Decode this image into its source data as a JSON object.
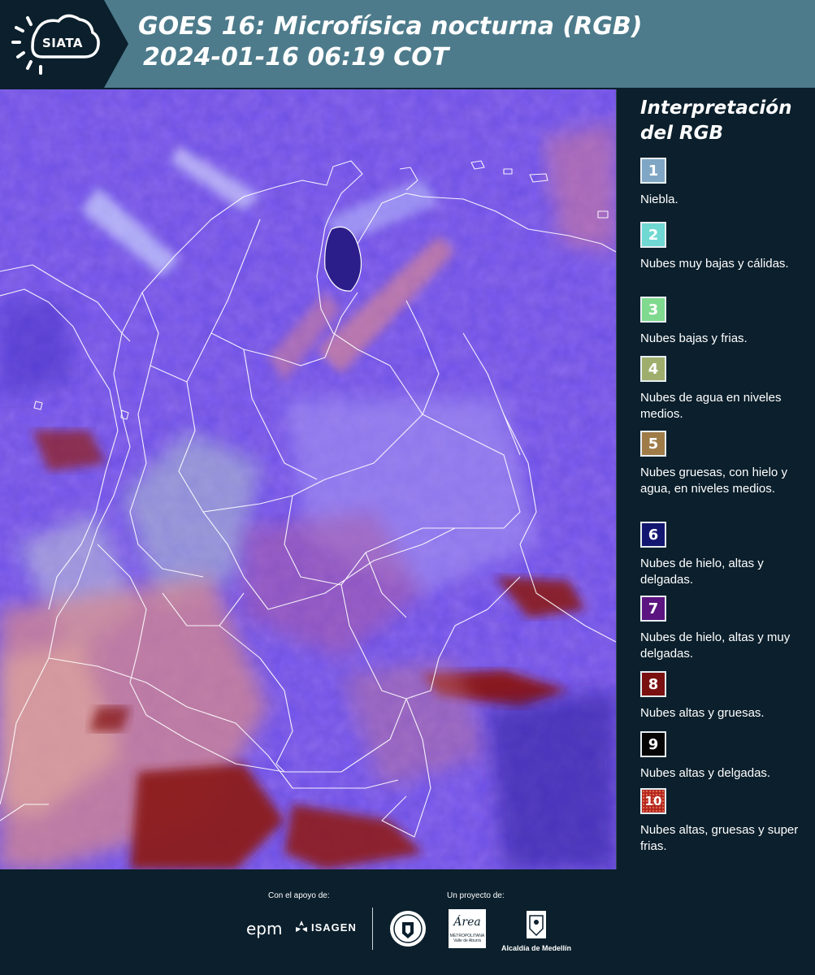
{
  "header": {
    "logo_text": "SIATA",
    "title_line1": "GOES 16: Microfísica nocturna (RGB)",
    "title_line2": "2024-01-16 06:19 COT"
  },
  "legend": {
    "title_line1": "Interpretación",
    "title_line2": "del RGB",
    "items": [
      {
        "number": "1",
        "color": "#7fa6c4",
        "label": "Niebla."
      },
      {
        "number": "2",
        "color": "#6fd8d2",
        "label": "Nubes muy bajas y cálidas."
      },
      {
        "number": "3",
        "color": "#7fd98e",
        "label": "Nubes bajas y frias."
      },
      {
        "number": "4",
        "color": "#9fae6c",
        "label": "Nubes de agua en niveles medios."
      },
      {
        "number": "5",
        "color": "#9f7b48",
        "label": "Nubes gruesas, con hielo y agua, en niveles medios."
      },
      {
        "number": "6",
        "color": "#131670",
        "label": "Nubes de hielo, altas y delgadas."
      },
      {
        "number": "7",
        "color": "#5b1480",
        "label": "Nubes de hielo, altas y muy delgadas."
      },
      {
        "number": "8",
        "color": "#7a1010",
        "label": "Nubes altas y gruesas."
      },
      {
        "number": "9",
        "color": "#050505",
        "label": "Nubes altas y delgadas."
      },
      {
        "number": "10",
        "color": "#b3261e",
        "label": "Nubes altas, gruesas y super frias."
      }
    ]
  },
  "footer": {
    "support_label": "Con el apoyo de:",
    "project_label": "Un proyecto de:",
    "logo_epm": "epm",
    "logo_isagen": "ISAGEN",
    "logo_area": "Área",
    "logo_area_sub1": "METROPOLITANA",
    "logo_area_sub2": "Valle de Aburrá",
    "logo_alcaldia": "Alcaldía de Medellín"
  },
  "colors": {
    "header_bg": "#4d7b8b",
    "page_bg": "#0b1f2c",
    "map_base": "#6a4ef0"
  }
}
